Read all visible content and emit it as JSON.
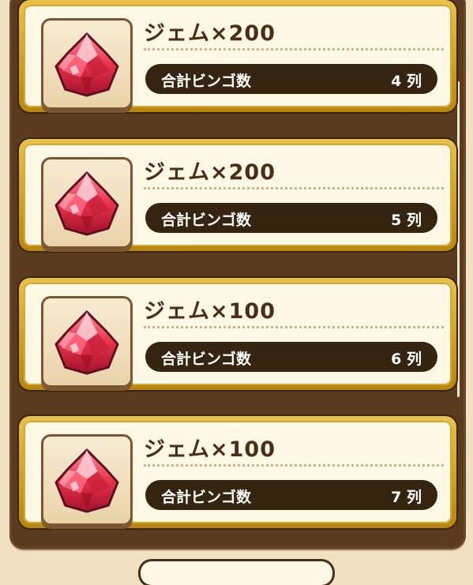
{
  "rewards": [
    {
      "title": "ジェム×200",
      "label": "合計ビンゴ数",
      "value": "4 列",
      "icon": "gem-icon"
    },
    {
      "title": "ジェム×200",
      "label": "合計ビンゴ数",
      "value": "5 列",
      "icon": "gem-icon"
    },
    {
      "title": "ジェム×100",
      "label": "合計ビンゴ数",
      "value": "6 列",
      "icon": "gem-icon"
    },
    {
      "title": "ジェム×100",
      "label": "合計ビンゴ数",
      "value": "7 列",
      "icon": "gem-icon"
    }
  ],
  "colors": {
    "panel": "#5a3b1e",
    "card_gold": "#d4a73a",
    "card_bg": "#fff8e5",
    "pill_bg": "#35240f",
    "title_text": "#4a2e15",
    "gem_red": "#e8324a"
  }
}
